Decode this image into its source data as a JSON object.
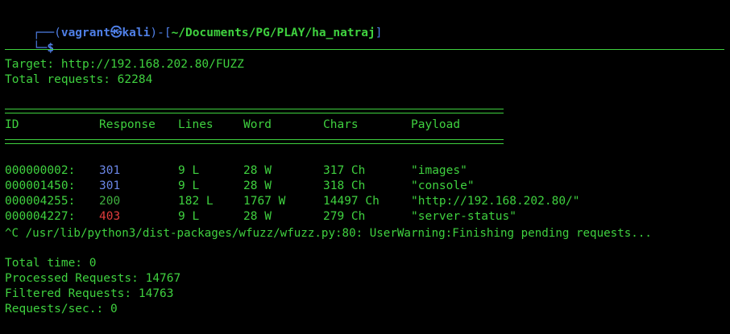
{
  "prompt": {
    "corner_top": "┌──(",
    "user": "vagrant",
    "at_symbol": "㉿",
    "host": "kali",
    "mid": ")-[",
    "path": "~/Documents/PG/PLAY/ha_natraj",
    "close": "]",
    "corner_bottom": "└─",
    "dollar": "$"
  },
  "info": {
    "target": "Target: http://192.168.202.80/FUZZ",
    "total_requests": "Total requests: 62284"
  },
  "table": {
    "headers": [
      "ID",
      "Response",
      "Lines",
      "Word",
      "Chars",
      "Payload"
    ],
    "rows": [
      {
        "id": "000000002:",
        "response": "301",
        "lines": "9 L",
        "word": "28 W",
        "chars": "317 Ch",
        "payload": "\"images\""
      },
      {
        "id": "000001450:",
        "response": "301",
        "lines": "9 L",
        "word": "28 W",
        "chars": "318 Ch",
        "payload": "\"console\""
      },
      {
        "id": "000004255:",
        "response": "200",
        "lines": "182 L",
        "word": "1767 W",
        "chars": "14497 Ch",
        "payload": "\"http://192.168.202.80/\""
      },
      {
        "id": "000004227:",
        "response": "403",
        "lines": "9 L",
        "word": "28 W",
        "chars": "279 Ch",
        "payload": "\"server-status\""
      }
    ]
  },
  "warning": "^C /usr/lib/python3/dist-packages/wfuzz/wfuzz.py:80: UserWarning:Finishing pending requests...",
  "summary": {
    "total_time": "Total time: 0",
    "processed": "Processed Requests: 14767",
    "filtered": "Filtered Requests: 14763",
    "rate": "Requests/sec.: 0"
  },
  "colors": {
    "background": "#000000",
    "text": "#3fd13f",
    "prompt_blue": "#4f7fe6",
    "status_301": "#6a86e6",
    "status_200": "#3fb03f",
    "status_403": "#e03c3c"
  }
}
